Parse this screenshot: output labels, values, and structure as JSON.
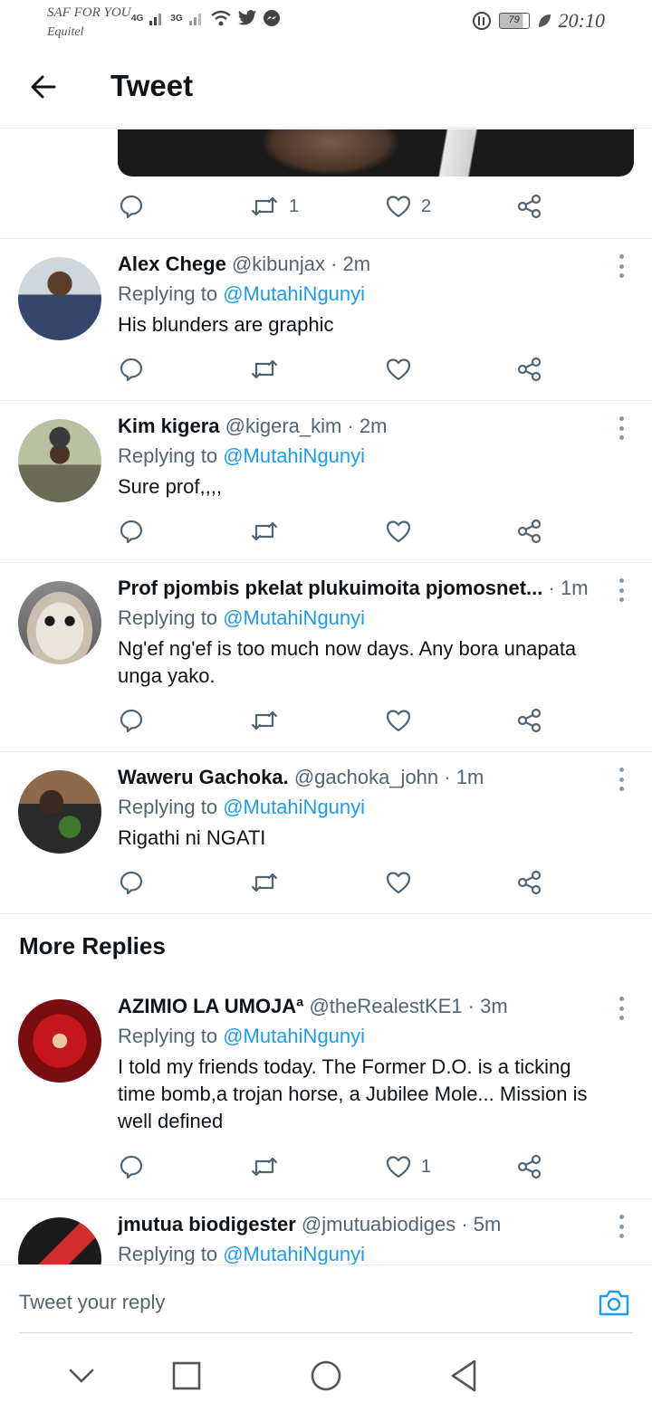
{
  "status_bar": {
    "carrier": "SAF FOR YOU",
    "carrier2": "Equitel",
    "net1": "4G",
    "net2": "3G",
    "battery": "79",
    "time": "20:10"
  },
  "header": {
    "title": "Tweet"
  },
  "main_tweet_actions": {
    "retweets": "1",
    "likes": "2"
  },
  "replies": [
    {
      "name": "Alex Chege",
      "handle": "@kibunjax · 2m",
      "replying": "Replying to ",
      "mention": "@MutahiNgunyi",
      "text": "His blunders are graphic",
      "likes": ""
    },
    {
      "name": "Kim kigera",
      "handle": "@kigera_kim · 2m",
      "replying": "Replying to ",
      "mention": "@MutahiNgunyi",
      "text": "Sure prof,,,,",
      "likes": ""
    },
    {
      "name": "Prof pjombis pkelat plukuimoita pjomosnet...",
      "handle": "· 1m",
      "replying": "Replying to ",
      "mention": "@MutahiNgunyi",
      "text": "Ng'ef ng'ef is too much now days. Any bora unapata unga yako.",
      "likes": ""
    },
    {
      "name": "Waweru Gachoka.",
      "handle": "@gachoka_john · 1m",
      "replying": "Replying to ",
      "mention": "@MutahiNgunyi",
      "text": "Rigathi ni NGATI",
      "likes": ""
    },
    {
      "name": "AZIMIO LA UMOJAª",
      "handle": "@theRealestKE1 · 3m",
      "replying": "Replying to ",
      "mention": "@MutahiNgunyi",
      "text": "I told my friends today. The Former D.O. is a ticking time bomb,a trojan horse, a Jubilee Mole... Mission is well defined",
      "likes": "1"
    },
    {
      "name": "jmutua biodigester",
      "handle": "@jmutuabiodiges · 5m",
      "replying": "Replying to ",
      "mention": "@MutahiNgunyi",
      "text": "",
      "likes": ""
    }
  ],
  "more_replies_title": "More Replies",
  "compose": {
    "placeholder": "Tweet your reply"
  },
  "colors": {
    "accent": "#1d9bf0",
    "secondary_text": "#536471",
    "divider": "#e6ecf0"
  }
}
